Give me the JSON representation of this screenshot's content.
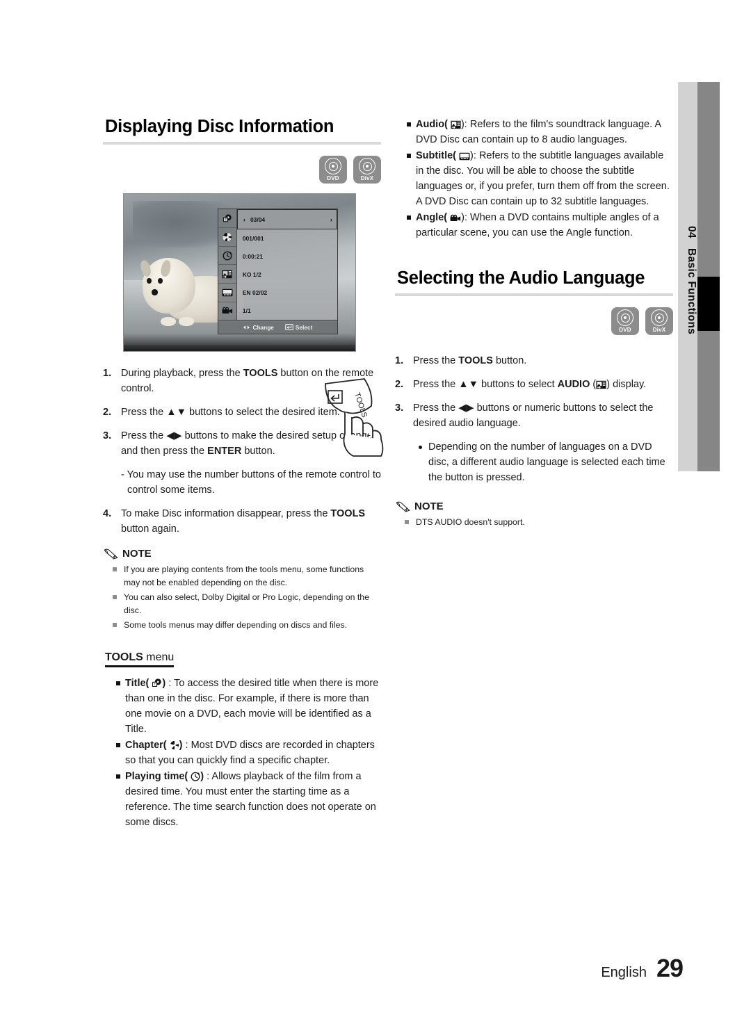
{
  "sidebar": {
    "number": "04",
    "label": "Basic Functions"
  },
  "left": {
    "heading": "Displaying Disc Information",
    "badges": [
      {
        "icon": "disc-icon",
        "label": "DVD"
      },
      {
        "icon": "disc-icon",
        "label": "DivX"
      }
    ],
    "osd": {
      "rows": [
        {
          "icon": "title-icon",
          "value": "03/04",
          "selected": true,
          "left_arrow": "‹",
          "right_arrow": "›"
        },
        {
          "icon": "chapter-icon",
          "value": "001/001",
          "selected": false
        },
        {
          "icon": "clock-icon",
          "value": "0:00:21",
          "selected": false
        },
        {
          "icon": "audio-icon",
          "value": "KO 1/2",
          "selected": false
        },
        {
          "icon": "subtitle-icon",
          "value": "EN 02/02",
          "selected": false
        },
        {
          "icon": "angle-icon",
          "value": "1/1",
          "selected": false
        }
      ],
      "footer": {
        "change": "Change",
        "select": "Select"
      }
    },
    "steps": [
      {
        "n": "1.",
        "parts": [
          {
            "t": "During playback, press the ",
            "b": false
          },
          {
            "t": "TOOLS",
            "b": true
          },
          {
            "t": " button on the remote control.",
            "b": false
          }
        ]
      },
      {
        "n": "2.",
        "parts": [
          {
            "t": "Press the ▲▼ buttons to select the desired item.",
            "b": false
          }
        ]
      },
      {
        "n": "3.",
        "parts": [
          {
            "t": "Press the ◀▶ buttons to make the desired setup change and then press the ",
            "b": false
          },
          {
            "t": "ENTER",
            "b": true
          },
          {
            "t": " button.",
            "b": false
          }
        ]
      },
      {
        "n": "4.",
        "parts": [
          {
            "t": "To make Disc information disappear, press the ",
            "b": false
          },
          {
            "t": "TOOLS",
            "b": true
          },
          {
            "t": " button again.",
            "b": false
          }
        ]
      }
    ],
    "step3_sub": "- You may use the number buttons of the remote control to control some items.",
    "note": {
      "title": "NOTE",
      "items": [
        "If you are playing contents from the tools menu, some functions may not be enabled depending on the disc.",
        "You can also select, Dolby Digital or Pro Logic, depending on the disc.",
        "Some tools menus may differ depending on discs and files."
      ]
    },
    "tools_menu": {
      "title_bold": "TOOLS",
      "title_rest": " menu",
      "items": [
        {
          "label": "Title",
          "icon": "title-icon",
          "text": " : To access the desired title when there is more than one in the disc. For example, if there is more than one movie on a DVD, each movie will be identified as a Title."
        },
        {
          "label": "Chapter",
          "icon": "chapter-icon",
          "text": " : Most DVD discs are recorded in chapters so that you can quickly find a specific chapter."
        },
        {
          "label": "Playing time",
          "icon": "clock-icon",
          "text": " : Allows playback of the film from a desired time. You must enter the starting time as a reference. The time search function does not operate on some discs."
        }
      ]
    }
  },
  "right": {
    "bullets": [
      {
        "label": "Audio",
        "icon": "audio-icon",
        "text": ": Refers to the film's soundtrack language. A DVD Disc can contain up to 8 audio languages."
      },
      {
        "label": "Subtitle",
        "icon": "subtitle-icon",
        "text": ": Refers to the subtitle languages available in the disc. You will be able to choose the subtitle languages or, if you prefer, turn them off from the screen. A DVD Disc can contain up to 32 subtitle languages."
      },
      {
        "label": "Angle",
        "icon": "angle-icon",
        "text": ": When a DVD contains multiple angles of a particular scene, you can use the Angle function."
      }
    ],
    "heading": "Selecting the Audio Language",
    "badges": [
      {
        "icon": "disc-icon",
        "label": "DVD"
      },
      {
        "icon": "disc-icon",
        "label": "DivX"
      }
    ],
    "steps": [
      {
        "n": "1.",
        "parts": [
          {
            "t": "Press the ",
            "b": false
          },
          {
            "t": "TOOLS",
            "b": true
          },
          {
            "t": " button.",
            "b": false
          }
        ]
      },
      {
        "n": "2.",
        "parts": [
          {
            "t": "Press the ▲▼ buttons to select ",
            "b": false
          },
          {
            "t": "AUDIO",
            "b": true
          },
          {
            "t": " (",
            "b": false
          },
          {
            "t": "@audio-icon",
            "b": false
          },
          {
            "t": ") display.",
            "b": false
          }
        ]
      },
      {
        "n": "3.",
        "parts": [
          {
            "t": "Press the ◀▶ buttons or numeric buttons to select the desired audio language.",
            "b": false
          }
        ]
      }
    ],
    "step3_dot": "Depending on the number of languages on a DVD disc, a different audio language is selected each time the button is pressed.",
    "note": {
      "title": "NOTE",
      "items": [
        "DTS AUDIO doesn't support."
      ]
    }
  },
  "footer": {
    "language": "English",
    "page": "29"
  }
}
